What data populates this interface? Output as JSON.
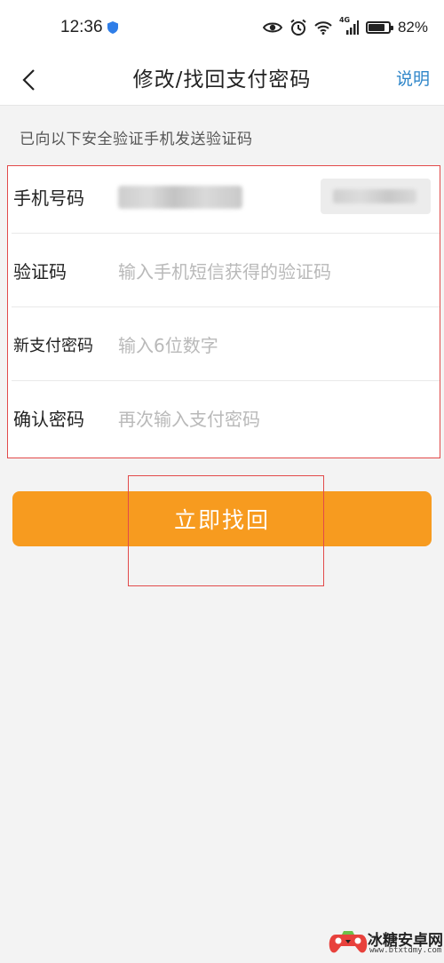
{
  "status_bar": {
    "time": "12:36",
    "network": "4G",
    "battery_percent": "82%",
    "battery_level": 0.82
  },
  "nav": {
    "title": "修改/找回支付密码",
    "help_label": "说明"
  },
  "hint": "已向以下安全验证手机发送验证码",
  "form": {
    "phone_label": "手机号码",
    "code_label": "验证码",
    "code_placeholder": "输入手机短信获得的验证码",
    "new_password_label": "新支付密码",
    "new_password_placeholder": "输入6位数字",
    "confirm_label": "确认密码",
    "confirm_placeholder": "再次输入支付密码"
  },
  "submit_label": "立即找回",
  "colors": {
    "accent": "#f79b1f",
    "link": "#2f86c9",
    "annotation": "#e24a4a"
  },
  "watermark": {
    "name": "冰糖安卓网",
    "url": "www.btxtdmy.com"
  }
}
